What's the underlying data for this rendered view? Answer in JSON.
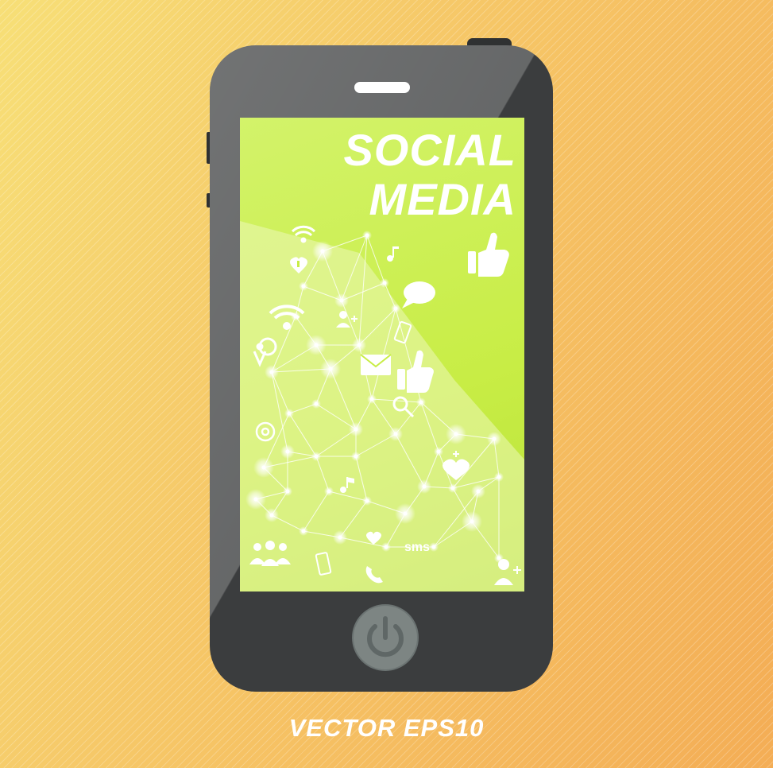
{
  "screen": {
    "title_line1": "SOCIAL",
    "title_line2": "MEDIA",
    "sms_label": "sms"
  },
  "caption": "VECTOR EPS10",
  "icons": [
    "wifi-icon",
    "heart-plus-icon",
    "music-note-icon",
    "thumbs-up-icon",
    "speech-bubble-icon",
    "user-add-icon",
    "phone-icon",
    "location-pin-icon",
    "mail-icon",
    "search-icon",
    "at-sign-icon",
    "group-icon",
    "handset-icon",
    "power-icon"
  ],
  "colors": {
    "background": "#f6c868",
    "phone_body": "#3b3d3e",
    "screen": "#c8ed45",
    "text": "#ffffff"
  }
}
